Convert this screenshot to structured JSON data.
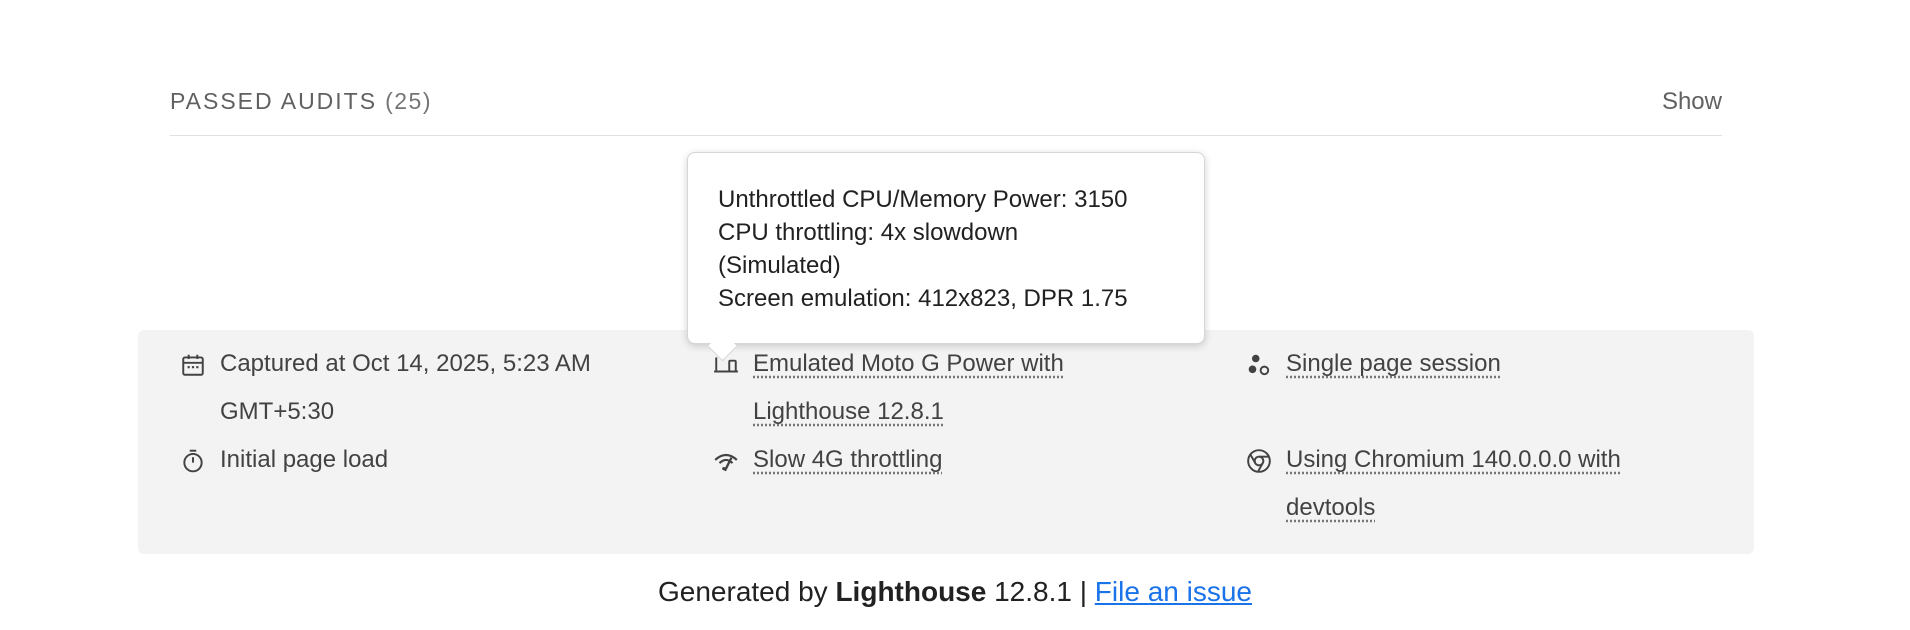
{
  "passed_audits": {
    "title": "PASSED AUDITS",
    "count": "(25)",
    "toggle_label": "Show"
  },
  "tooltip": {
    "lines": [
      "Unthrottled CPU/Memory Power: 3150",
      "CPU throttling: 4x slowdown",
      "(Simulated)",
      "Screen emulation: 412x823, DPR 1.75"
    ]
  },
  "environment": {
    "captured_line1": "Captured at Oct 14, 2025, 5:23 AM",
    "captured_line2": "GMT+5:30",
    "page_load": "Initial page load",
    "device_line1": "Emulated Moto G Power with",
    "device_line2": "Lighthouse 12.8.1",
    "throttling": "Slow 4G throttling",
    "session": "Single page session",
    "browser_line1": "Using Chromium 140.0.0.0 with",
    "browser_line2": "devtools",
    "icons": {
      "captured": "calendar-icon",
      "page_load": "stopwatch-icon",
      "device": "devices-icon",
      "throttling": "network-icon",
      "session": "session-icon",
      "browser": "chrome-icon"
    }
  },
  "footer": {
    "prefix": "Generated by",
    "brand": "Lighthouse",
    "version": "12.8.1 |",
    "link_label": "File an issue"
  },
  "colors": {
    "link_blue": "#1a73e8",
    "panel_bg": "#f3f3f3"
  }
}
